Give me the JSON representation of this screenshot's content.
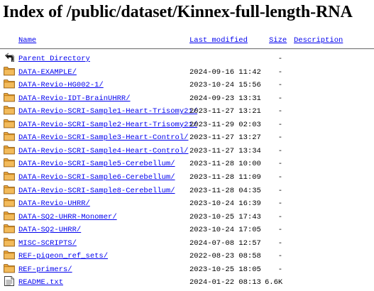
{
  "page": {
    "title": "Index of /public/dataset/Kinnex-full-length-RNA"
  },
  "columns": {
    "name": "Name",
    "last_modified": "Last modified",
    "size": "Size",
    "description": "Description"
  },
  "colors": {
    "link": "#0000ee",
    "folder": "#e8a33a",
    "rule": "#7a7a7a"
  },
  "rows": [
    {
      "name": "Parent Directory",
      "date": "",
      "size": "-",
      "icon": "back-arrow-icon"
    },
    {
      "name": "DATA-EXAMPLE/",
      "date": "2024-09-16 11:42",
      "size": "-",
      "icon": "folder-icon"
    },
    {
      "name": "DATA-Revio-HG002-1/",
      "date": "2023-10-24 15:56",
      "size": "-",
      "icon": "folder-icon"
    },
    {
      "name": "DATA-Revio-IDT-BrainUHRR/",
      "date": "2024-09-23 13:31",
      "size": "-",
      "icon": "folder-icon"
    },
    {
      "name": "DATA-Revio-SCRI-Sample1-Heart-Trisomy21/",
      "date": "2023-11-27 13:21",
      "size": "-",
      "icon": "folder-icon"
    },
    {
      "name": "DATA-Revio-SCRI-Sample2-Heart-Trisomy21/",
      "date": "2023-11-29 02:03",
      "size": "-",
      "icon": "folder-icon"
    },
    {
      "name": "DATA-Revio-SCRI-Sample3-Heart-Control/",
      "date": "2023-11-27 13:27",
      "size": "-",
      "icon": "folder-icon"
    },
    {
      "name": "DATA-Revio-SCRI-Sample4-Heart-Control/",
      "date": "2023-11-27 13:34",
      "size": "-",
      "icon": "folder-icon"
    },
    {
      "name": "DATA-Revio-SCRI-Sample5-Cerebellum/",
      "date": "2023-11-28 10:00",
      "size": "-",
      "icon": "folder-icon"
    },
    {
      "name": "DATA-Revio-SCRI-Sample6-Cerebellum/",
      "date": "2023-11-28 11:09",
      "size": "-",
      "icon": "folder-icon"
    },
    {
      "name": "DATA-Revio-SCRI-Sample8-Cerebellum/",
      "date": "2023-11-28 04:35",
      "size": "-",
      "icon": "folder-icon"
    },
    {
      "name": "DATA-Revio-UHRR/",
      "date": "2023-10-24 16:39",
      "size": "-",
      "icon": "folder-icon"
    },
    {
      "name": "DATA-SQ2-UHRR-Monomer/",
      "date": "2023-10-25 17:43",
      "size": "-",
      "icon": "folder-icon"
    },
    {
      "name": "DATA-SQ2-UHRR/",
      "date": "2023-10-24 17:05",
      "size": "-",
      "icon": "folder-icon"
    },
    {
      "name": "MISC-SCRIPTS/",
      "date": "2024-07-08 12:57",
      "size": "-",
      "icon": "folder-icon"
    },
    {
      "name": "REF-pigeon_ref_sets/",
      "date": "2022-08-23 08:58",
      "size": "-",
      "icon": "folder-icon"
    },
    {
      "name": "REF-primers/",
      "date": "2023-10-25 18:05",
      "size": "-",
      "icon": "folder-icon"
    },
    {
      "name": "README.txt",
      "date": "2024-01-22 08:13",
      "size": "6.6K",
      "icon": "text-file-icon"
    }
  ]
}
